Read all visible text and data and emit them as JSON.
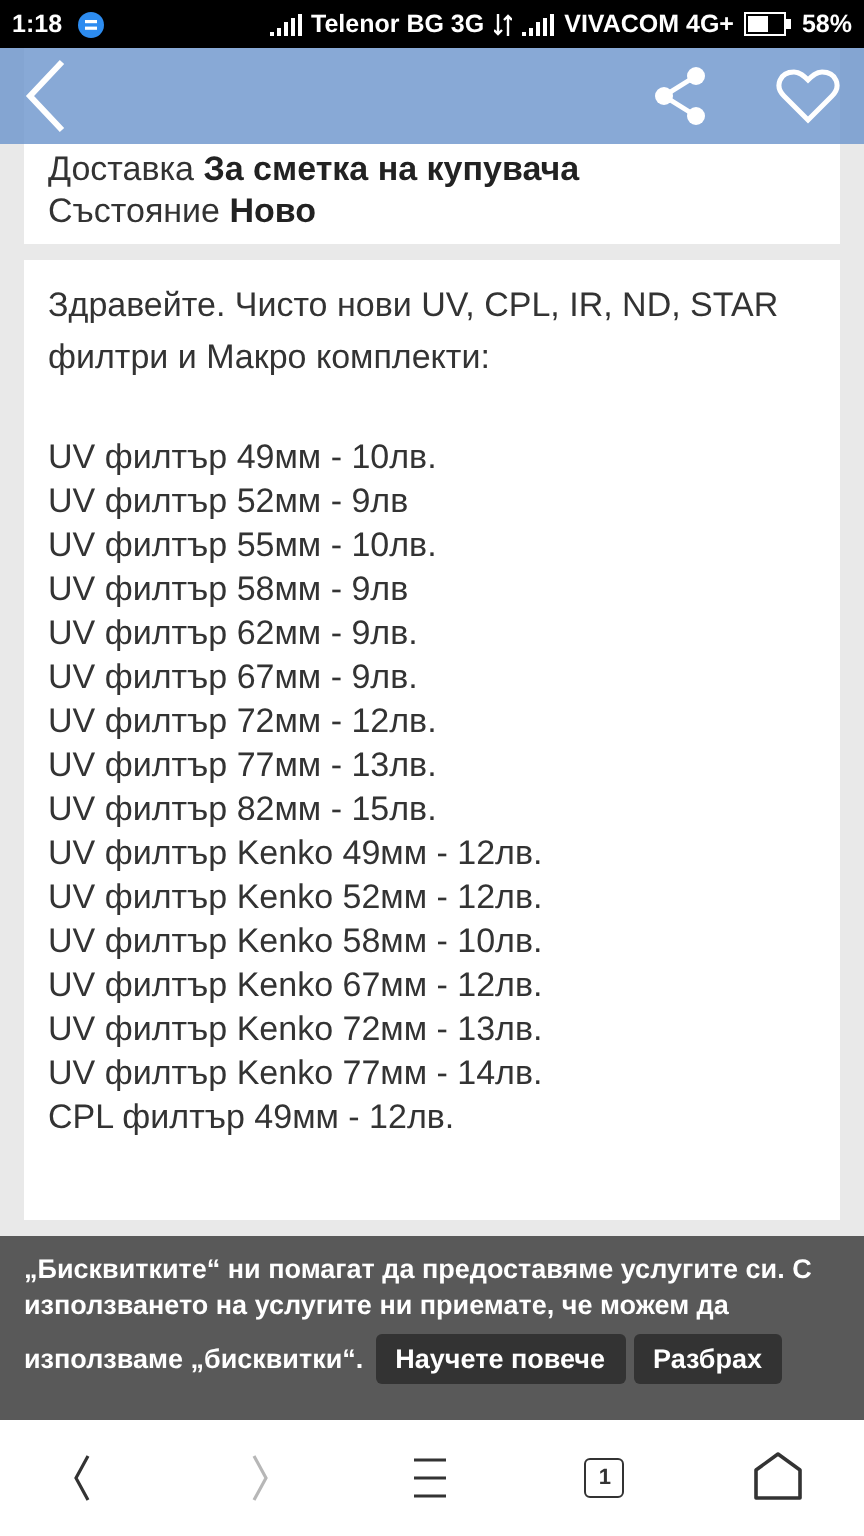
{
  "status_bar": {
    "time": "1:18",
    "carrier_1": "Telenor BG 3G",
    "carrier_2": "VIVACOM 4G+",
    "battery": "58%"
  },
  "details": [
    "Доставка **За сметка на купувача**",
    "Състояние **Ново**"
  ],
  "description": {
    "intro": "Здравейте. Чисто нови UV, CPL, IR, ND, STAR филтри и Макро комплекти:",
    "lines": [
      "UV филтър 49мм - 10лв.",
      "UV филтър 52мм - 9лв",
      "UV филтър 55мм - 10лв.",
      "UV филтър 58мм - 9лв",
      "UV филтър 62мм - 9лв.",
      "UV филтър 67мм - 9лв.",
      "UV филтър 72мм - 12лв.",
      "UV филтър 77мм - 13лв.",
      "UV филтър 82мм - 15лв.",
      "UV филтър Kenko 49мм - 12лв.",
      "UV филтър Kenko 52мм - 12лв.",
      "UV филтър Kenko 58мм - 10лв.",
      "UV филтър Kenko 67мм - 12лв.",
      "UV филтър Kenko 72мм - 13лв.",
      "UV филтър Kenko 77мм - 14лв.",
      "CPL филтър 49мм - 12лв."
    ]
  },
  "cookie_notice": {
    "text": "„Бисквитките“ ни помагат да предоставяме услугите си. С използването на услугите ни приемате, че можем да",
    "text_continued": "използваме „бисквитки“.",
    "buttons": [
      "Научете повече",
      "Разбрах"
    ]
  },
  "browser_nav": [
    {
      "kind": "back",
      "disabled": false
    },
    {
      "kind": "forward",
      "disabled": true
    },
    {
      "kind": "menu",
      "disabled": false
    },
    {
      "kind": "tabs",
      "disabled": false,
      "count": "1"
    },
    {
      "kind": "home",
      "disabled": false
    }
  ]
}
